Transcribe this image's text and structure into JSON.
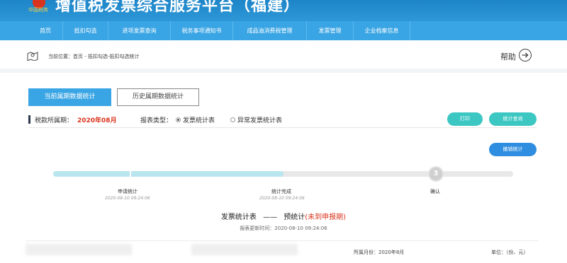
{
  "header": {
    "logo_text": "中国税务",
    "title": "增值税发票综合服务平台（福建）"
  },
  "nav": {
    "items": [
      "首页",
      "抵扣勾选",
      "进项发票查询",
      "税务事项通知书",
      "成品油消费税管理",
      "发票管理",
      "企业档案信息"
    ]
  },
  "breadcrumb": {
    "text": "当前位置：首页 - 抵扣勾选-抵扣勾选统计",
    "help": "帮助"
  },
  "tabs": {
    "current": "当前属期数据统计",
    "history": "历史属期数据统计"
  },
  "filter": {
    "period_label": "税款所属期：",
    "period_value": "2020年08月",
    "type_label": "报表类型：",
    "options": [
      "发票统计表",
      "异常发票统计表"
    ],
    "selected": "发票统计表"
  },
  "buttons": {
    "print": "打印",
    "query": "统计查询",
    "cancel": "撤销统计"
  },
  "steps": [
    {
      "name": "申请统计",
      "time": "2020-08-10 09:24:06",
      "number": ""
    },
    {
      "name": "统计完成",
      "time": "2020-08-10 09:24:06",
      "number": ""
    },
    {
      "name": "确认",
      "time": "",
      "number": "3"
    }
  ],
  "progress": {
    "completed_fraction": 0.5
  },
  "stats": {
    "title_main": "发票统计表",
    "dash": "——",
    "title_sub": "预统计",
    "title_note": "(未到申报期)",
    "update_time": "报表更新时间：2020-08-10 09:24:06"
  },
  "footer": {
    "month": "所属月份：2020年8月",
    "unit": "单位：（份、元）"
  },
  "colors": {
    "header": "#1e86c8",
    "nav": "#3aa5e4",
    "accent_teal": "#3cc7c3",
    "accent_blue": "#2f8ee0",
    "highlight_red": "#d9341e"
  }
}
